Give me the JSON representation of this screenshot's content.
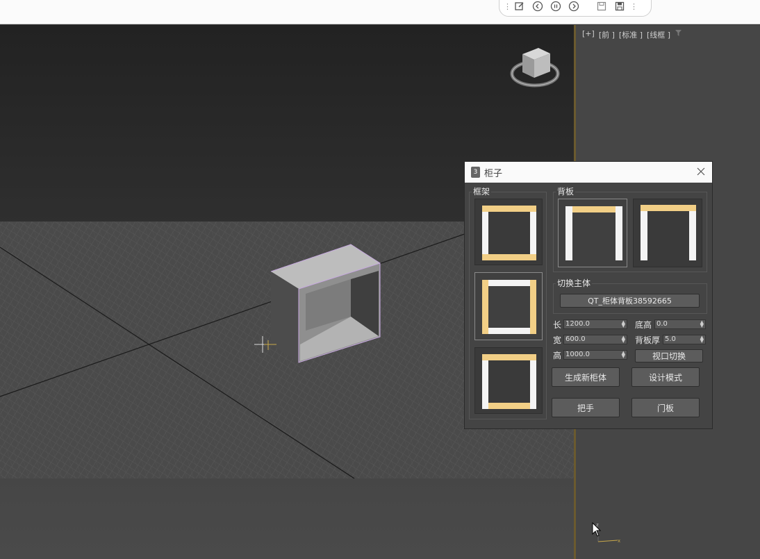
{
  "toolbar": {
    "icons": [
      "drag-handle-icon",
      "edit-icon",
      "previous-icon",
      "pause-icon",
      "next-icon",
      "save-icon",
      "save-as-icon",
      "drag-handle-icon"
    ]
  },
  "viewport": {
    "label_plus": "[+]",
    "label_view": "[前 ]",
    "label_shading": "[标准 ]",
    "label_mode": "[线框 ]"
  },
  "dialog": {
    "title": "柜子",
    "app_icon_text": "3",
    "frame_group": "框架",
    "back_group": "背板",
    "switch_group": "切换主体",
    "switch_value": "QT_柜体背板38592665",
    "fields": {
      "length_label": "长",
      "length_value": "1200.0",
      "width_label": "宽",
      "width_value": "600.0",
      "height_label": "高",
      "height_value": "1000.0",
      "base_label": "底高",
      "base_value": "0.0",
      "back_thick_label": "背板厚",
      "back_thick_value": "5.0"
    },
    "buttons": {
      "view_switch": "视口切换",
      "new_cabinet": "生成新柜体",
      "design_mode": "设计模式",
      "handle": "把手",
      "door": "门板"
    }
  },
  "colors": {
    "accent_panel": "#f2cf86",
    "white_panel": "#f4f4f4",
    "viewport_separator": "#6b5a2e"
  }
}
